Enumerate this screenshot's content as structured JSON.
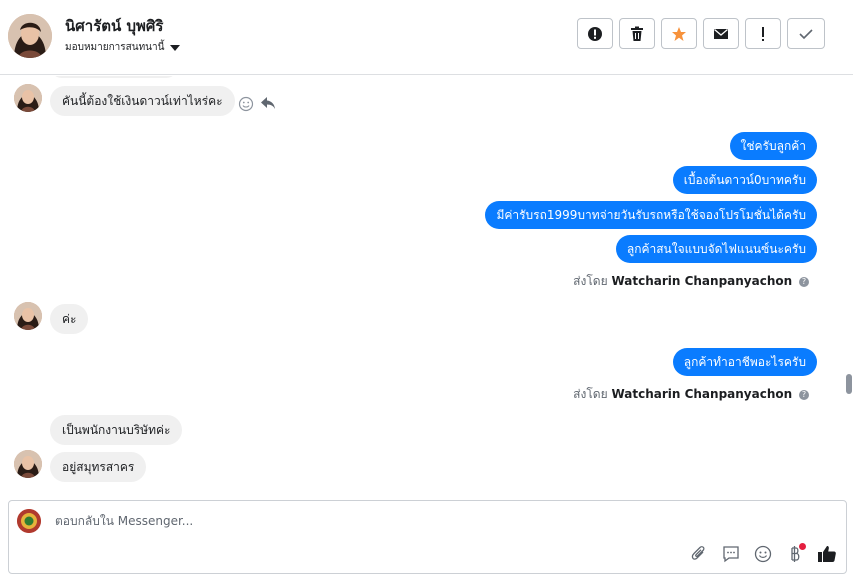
{
  "header": {
    "contact_name": "นิศารัตน์ บุพศิริ",
    "assign_label": "มอบหมายการสนทนานี้",
    "toolbar_icons": [
      "alert-icon",
      "trash-icon",
      "star-icon",
      "mail-icon",
      "exclamation-icon",
      "check-icon"
    ],
    "star_color": "#f7923b"
  },
  "messages": {
    "incoming_1": "คันนี้ต้องใช้เงินดาวน์เท่าไหร่คะ",
    "outgoing_group_1": [
      "ใช่ครับลูกค้า",
      "เบื้องต้นดาวน์0บาทครับ",
      "มีค่ารับรถ1999บาทจ่ายวันรับรถหรือใช้จองโปรโมชั่นได้ครับ",
      "ลูกค้าสนใจแบบจัดไฟแนนซ์นะครับ"
    ],
    "sent_by_prefix": "ส่งโดย",
    "sent_by_name": "Watcharin Chanpanyachon",
    "incoming_2": "ค่ะ",
    "outgoing_group_2": [
      "ลูกค้าทำอาชีพอะไรครับ"
    ],
    "incoming_3": [
      "เป็นพนักงานบริษัทค่ะ",
      "อยู่สมุทรสาคร"
    ],
    "outgoing_color": "#0a7cff",
    "incoming_color": "#f0f0f0"
  },
  "composer": {
    "placeholder": "ตอบกลับใน Messenger...",
    "tool_icons": [
      "paperclip-icon",
      "saved-reply-icon",
      "emoji-icon",
      "baht-icon",
      "thumbs-up-icon"
    ]
  }
}
